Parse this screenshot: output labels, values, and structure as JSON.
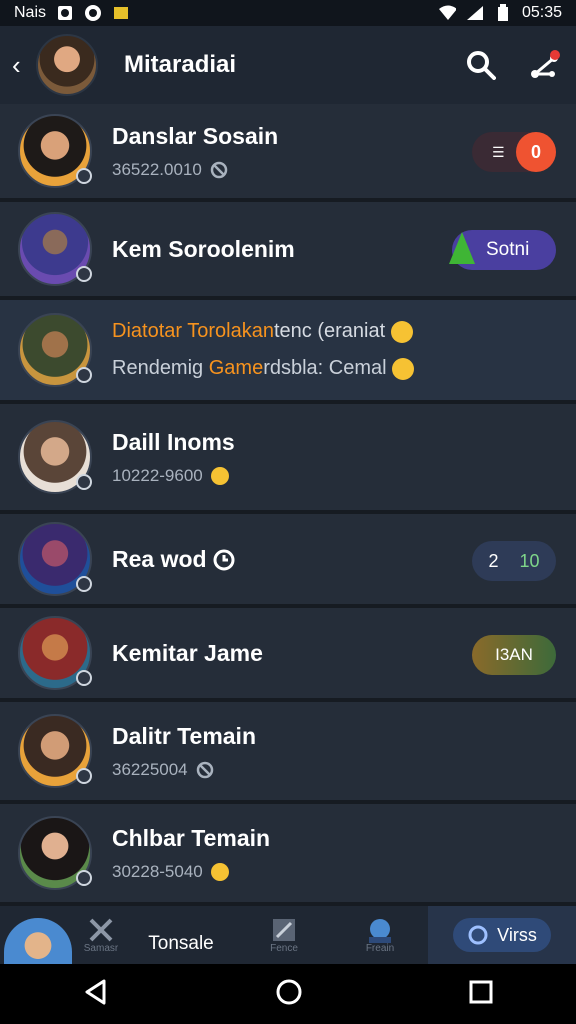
{
  "status": {
    "left_text": "Nais",
    "time": "05:35"
  },
  "header": {
    "title": "Mitaradiai"
  },
  "rows": [
    {
      "name": "Danslar Sosain",
      "sub": "36522.0010",
      "pill": "0"
    },
    {
      "name": "Kem Soroolenim",
      "pill": "Sotni"
    },
    {
      "line1_orange": "Diatotar Torolakan",
      "line1_rest": "tenc (eraniat",
      "line2_a": "Rendemig",
      "line2_orange": "Game",
      "line2_b": "rdsbla: Cemal"
    },
    {
      "name": "Daill Inoms",
      "sub": "10222-9600"
    },
    {
      "name": "Rea wod",
      "pill_a": "2",
      "pill_b": "10"
    },
    {
      "name": "Kemitar Jame",
      "pill": "I3AN"
    },
    {
      "name": "Dalitr Temain",
      "sub": "36225004"
    },
    {
      "name": "Chlbar Temain",
      "sub": "30228-5040"
    }
  ],
  "tabbar": {
    "tab_labels": [
      "Samasr",
      "Tonsale",
      "Fence",
      "Freain"
    ],
    "active_label": "Virss"
  },
  "colors": {
    "accent_orange": "#f7931e",
    "pill_red": "#ef5331",
    "pill_purple": "#4a3fa0"
  }
}
